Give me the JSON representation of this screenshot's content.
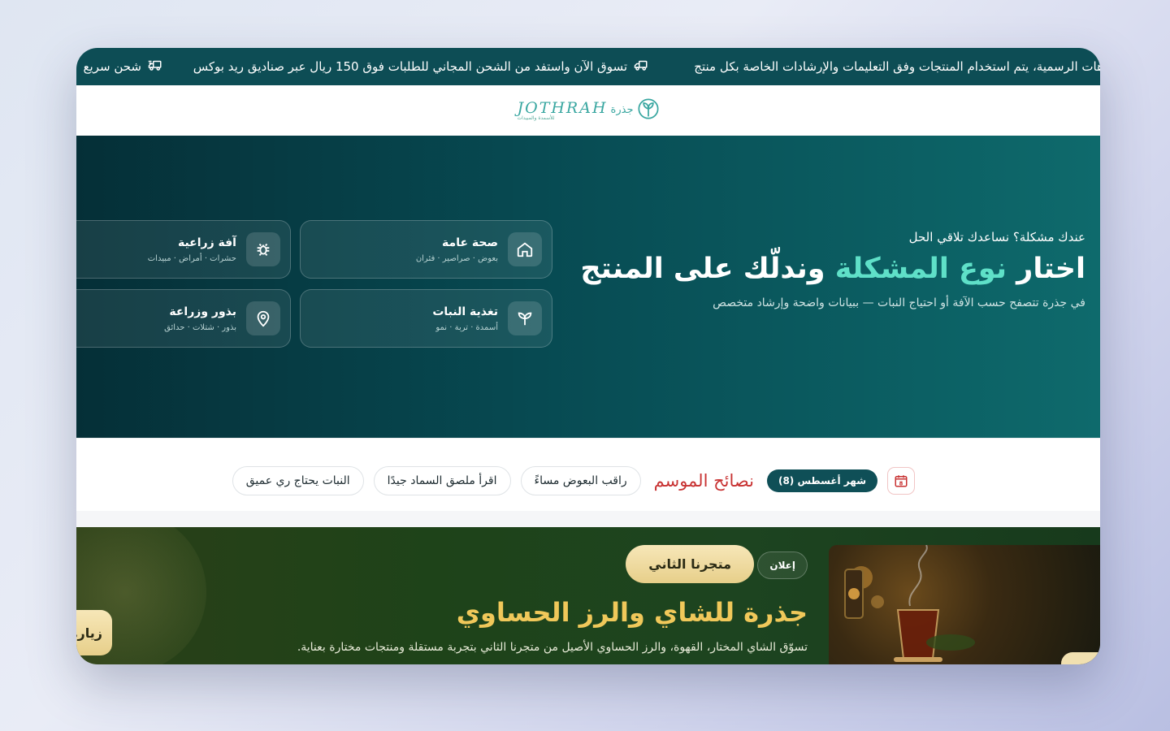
{
  "ticker": {
    "items": [
      {
        "text": "هات الرسمية، يتم استخدام المنتجات وفق التعليمات والإرشادات الخاصة بكل منتج",
        "icon": "none"
      },
      {
        "text": "تسوق الآن واستفد من الشحن المجاني للطلبات فوق 150 ريال عبر صناديق ريد بوكس",
        "icon": "truck-icon"
      },
      {
        "text": "شحن سريع",
        "icon": "fast-delivery-icon"
      }
    ]
  },
  "header": {
    "logo_latin": "JOTHRAH",
    "logo_arabic": "جذرة",
    "logo_tagline": "للأسمدة والمبيدات"
  },
  "hero": {
    "kicker": "عندك مشكلة؟ نساعدك تلاقي الحل",
    "title_part1": "اختار ",
    "title_accent": "نوع المشكلة",
    "title_part2": " وندلّك على المنتج",
    "subtitle": "في جذرة تتصفح حسب الآفة أو احتياج النبات — ببيانات واضحة وإرشاد متخصص",
    "cards": [
      {
        "title": "صحة عامة",
        "subtitle": "بعوض · صراصير · فئران",
        "icon": "home-icon"
      },
      {
        "title": "آفة زراعية",
        "subtitle": "حشرات · أمراض · مبيدات",
        "icon": "bug-icon"
      },
      {
        "title": "تغذية النبات",
        "subtitle": "أسمدة · تربة · نمو",
        "icon": "sprout-icon"
      },
      {
        "title": "بذور وزراعة",
        "subtitle": "بذور · شتلات · حدائق",
        "icon": "map-pin-icon"
      }
    ]
  },
  "tips": {
    "calendar_day": "8",
    "month_label": "شهر أغسطس (8)",
    "season_title": "نصائح الموسم",
    "chips": [
      "راقب البعوض مساءً",
      "اقرأ ملصق السماد جيدًا",
      "النبات يحتاج ري عميق"
    ]
  },
  "ad": {
    "badge": "إعلان",
    "store_button": "متجرنا الثاني",
    "title": "جذرة للشاي والرز الحساوي",
    "subtitle": "تسوّق الشاي المختار، القهوة، والرز الحساوي الأصيل من متجرنا الثاني بتجربة مستقلة ومنتجات مختارة بعناية.",
    "visit_button": "زيارة"
  },
  "colors": {
    "ticker_bg": "#0d4d55",
    "accent_teal": "#5fe0c8",
    "season_red": "#c83232",
    "ad_gold": "#f0c85a"
  }
}
